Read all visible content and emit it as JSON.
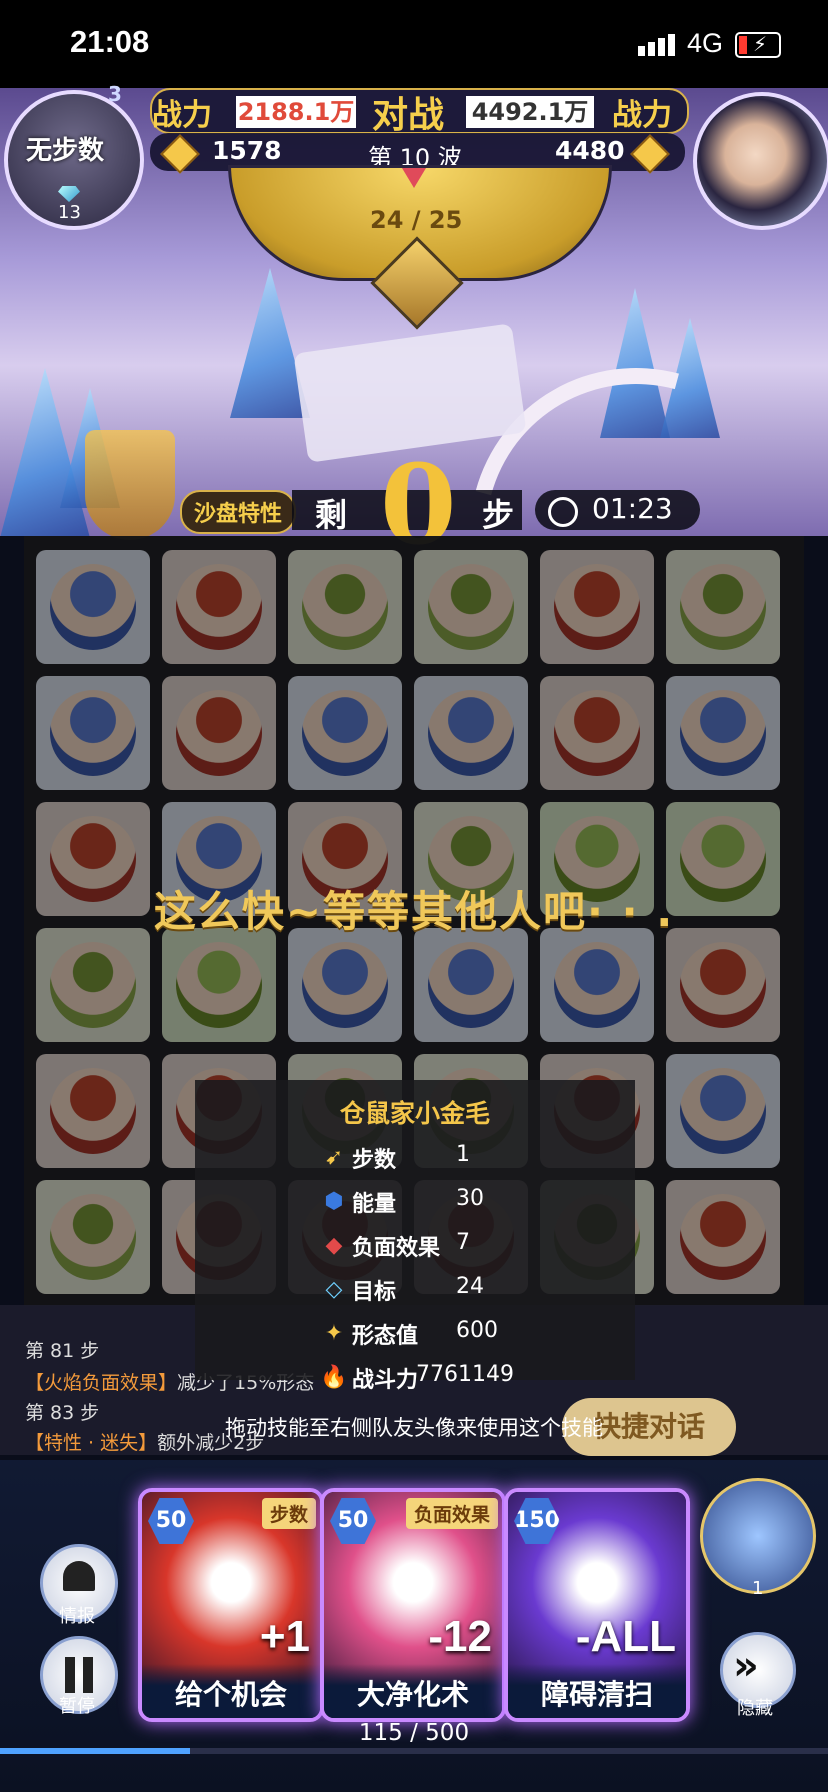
{
  "status_bar": {
    "time": "21:08",
    "network": "4G"
  },
  "player_left": {
    "label": "无步数",
    "gems": "13",
    "level": "3"
  },
  "battle_header": {
    "power_label": "战力",
    "left_power": "2188.1万",
    "vs_label": "对战",
    "right_power": "4492.1万",
    "left_score": "1578",
    "wave": "第 10 波",
    "right_score": "4480",
    "progress": "24 / 25"
  },
  "strip": {
    "sand_tag": "沙盘特性",
    "remain_label": "剩",
    "steps": "0",
    "step_unit": "步",
    "timer": "01:23"
  },
  "board": {
    "banner": "这么快~等等其他人吧· · .",
    "rows": [
      [
        "blue",
        "red",
        "green",
        "green",
        "red",
        "green"
      ],
      [
        "blue",
        "red",
        "blue",
        "blue",
        "red",
        "blue"
      ],
      [
        "red",
        "blue",
        "red",
        "green",
        "horn",
        "horn"
      ],
      [
        "green",
        "horn",
        "blue",
        "blue",
        "blue",
        "red"
      ],
      [
        "red",
        "red",
        "green",
        "green",
        "red",
        "blue"
      ],
      [
        "green",
        "red",
        "red",
        "red",
        "green",
        "red"
      ]
    ]
  },
  "info_card": {
    "name": "仓鼠家小金毛",
    "stats": [
      {
        "icon": "steps-icon",
        "label": "步数",
        "value": "1"
      },
      {
        "icon": "energy-icon",
        "label": "能量",
        "value": "30"
      },
      {
        "icon": "debuff-icon",
        "label": "负面效果",
        "value": "7"
      },
      {
        "icon": "target-icon",
        "label": "目标",
        "value": "24"
      },
      {
        "icon": "form-icon",
        "label": "形态值",
        "value": "600"
      },
      {
        "icon": "combat-icon",
        "label": "战斗力",
        "value": "7761149"
      }
    ]
  },
  "log": {
    "line1": "第 81 步",
    "line2_tag": "【火焰负面效果】",
    "line2_text": "减少了15%形态",
    "line3": "第 83 步",
    "line4_tag": "【特性 · 迷失】",
    "line4_text": "额外减少2步",
    "hint": "拖动技能至右侧队友头像来使用这个技能",
    "chat_button": "快捷对话"
  },
  "skills": [
    {
      "cost": "50",
      "tag": "步数",
      "badge": "+1",
      "name": "给个机会",
      "color": "#d8362a"
    },
    {
      "cost": "50",
      "tag": "负面效果",
      "badge": "-12",
      "name": "大净化术",
      "color": "#e0508a"
    },
    {
      "cost": "150",
      "tag": "",
      "badge": "-ALL",
      "name": "障碍清扫",
      "color": "#6a3ad0"
    }
  ],
  "controls": {
    "info": "情报",
    "pause": "暂停",
    "hide": "隐藏",
    "ally_count": "1"
  },
  "energy": {
    "text": "115 / 500",
    "fraction": 0.23
  }
}
